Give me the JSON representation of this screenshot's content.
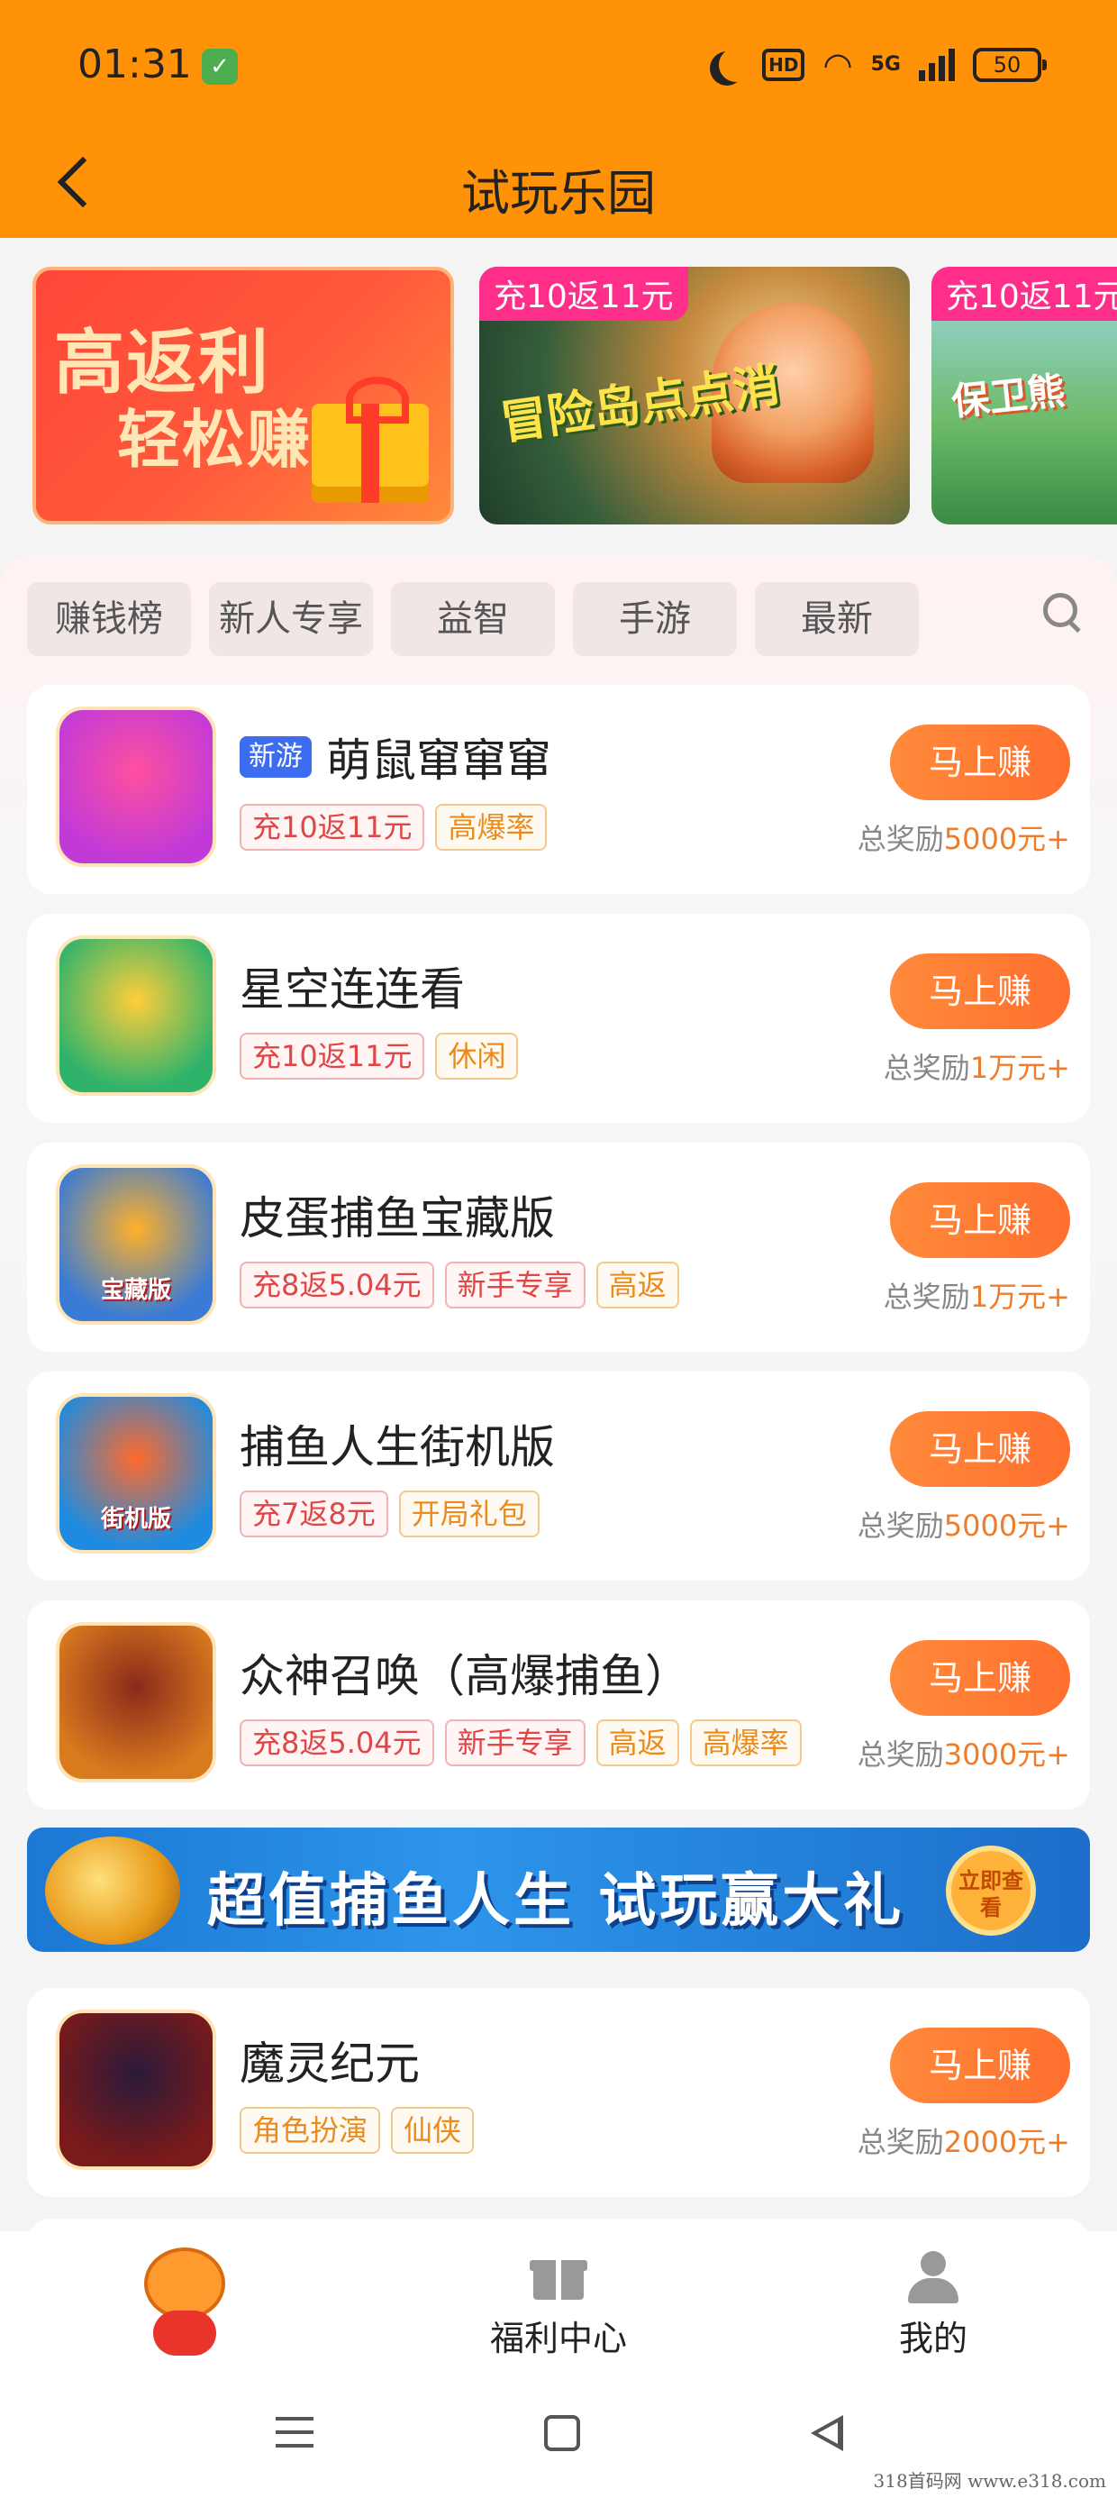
{
  "status_bar": {
    "time": "01:31",
    "network": "5G",
    "hd_label": "HD",
    "battery": "50"
  },
  "header": {
    "title": "试玩乐园"
  },
  "banners": [
    {
      "line1": "高返利",
      "line2": "轻松赚"
    },
    {
      "tag": "充10返11元",
      "game": "冒险岛点点消"
    },
    {
      "tag": "充10返11元",
      "game": "保卫熊"
    }
  ],
  "tabs": [
    "赚钱榜",
    "新人专享",
    "益智",
    "手游",
    "最新"
  ],
  "games": [
    {
      "new_badge": "新游",
      "name": "萌鼠窜窜窜",
      "tags": [
        {
          "text": "充10返11元",
          "style": "red"
        },
        {
          "text": "高爆率",
          "style": "org"
        }
      ],
      "button": "马上赚",
      "reward_prefix": "总奖励",
      "reward_amount": "5000元+",
      "icon_colors": [
        "#c13ad8",
        "#ff4fa0"
      ]
    },
    {
      "name": "星空连连看",
      "tags": [
        {
          "text": "充10返11元",
          "style": "red"
        },
        {
          "text": "休闲",
          "style": "org"
        }
      ],
      "button": "马上赚",
      "reward_prefix": "总奖励",
      "reward_amount": "1万元+",
      "icon_colors": [
        "#2fb36b",
        "#ffce3a"
      ]
    },
    {
      "name": "皮蛋捕鱼宝藏版",
      "tags": [
        {
          "text": "充8返5.04元",
          "style": "red"
        },
        {
          "text": "新手专享",
          "style": "red"
        },
        {
          "text": "高返",
          "style": "org"
        }
      ],
      "button": "马上赚",
      "reward_prefix": "总奖励",
      "reward_amount": "1万元+",
      "icon_colors": [
        "#3a7bd5",
        "#ffb02a"
      ],
      "icon_text": "宝藏版"
    },
    {
      "name": "捕鱼人生街机版",
      "tags": [
        {
          "text": "充7返8元",
          "style": "red"
        },
        {
          "text": "开局礼包",
          "style": "org"
        }
      ],
      "button": "马上赚",
      "reward_prefix": "总奖励",
      "reward_amount": "5000元+",
      "icon_colors": [
        "#1f8be0",
        "#ff6a2a"
      ],
      "icon_text": "街机版"
    },
    {
      "name": "众神召唤（高爆捕鱼）",
      "tags": [
        {
          "text": "充8返5.04元",
          "style": "red"
        },
        {
          "text": "新手专享",
          "style": "red"
        },
        {
          "text": "高返",
          "style": "org"
        },
        {
          "text": "高爆率",
          "style": "org"
        }
      ],
      "button": "马上赚",
      "reward_prefix": "总奖励",
      "reward_amount": "3000元+",
      "icon_colors": [
        "#d97a1f",
        "#8a2a1a"
      ]
    },
    {
      "name": "魔灵纪元",
      "tags": [
        {
          "text": "角色扮演",
          "style": "org"
        },
        {
          "text": "仙侠",
          "style": "org"
        }
      ],
      "button": "马上赚",
      "reward_prefix": "总奖励",
      "reward_amount": "2000元+",
      "icon_colors": [
        "#7a1a1a",
        "#2a1a3a"
      ]
    }
  ],
  "promo_banner": {
    "text": "超值捕鱼人生 试玩赢大礼",
    "cta": "立即查看"
  },
  "bottom_nav": [
    {
      "label": ""
    },
    {
      "label": "福利中心"
    },
    {
      "label": "我的"
    }
  ],
  "watermark": "318首码网 www.e318.com",
  "colors": {
    "header": "#ff9207",
    "button": "#ff7a30",
    "reward": "#f07c2a"
  }
}
